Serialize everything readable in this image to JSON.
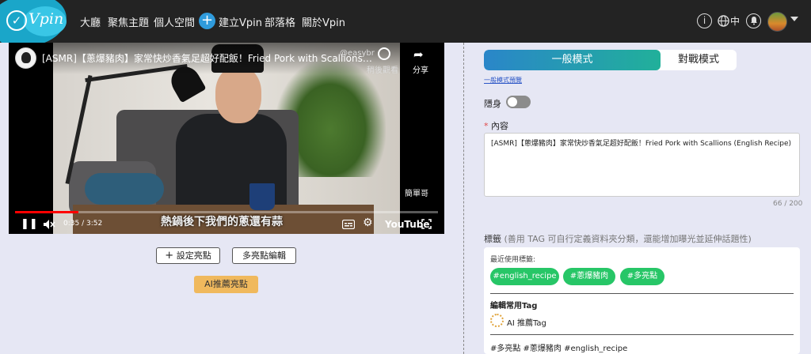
{
  "nav": {
    "logo_text": "Vpin",
    "items": [
      "大廳",
      "聚焦主題",
      "個人空間"
    ],
    "create": "建立Vpin",
    "blog": "部落格",
    "about": "關於Vpin",
    "info_icon": "i",
    "lang": "中"
  },
  "video": {
    "title": "[ASMR]【蔥爆豬肉】家常快炒香氣足超好配飯！Fried Pork with Scallions (English Recipe)",
    "watermark": "@easybr",
    "later_label": "稍後觀看",
    "share_label": "分享",
    "signature": "簡單哥",
    "subtitle": "熱鍋後下我們的蔥還有蒜",
    "time": "0:35 / 3:52",
    "progress": 0.15,
    "brand": "YouTube"
  },
  "actions": {
    "set_highlight": "設定亮點",
    "multi_edit": "多亮點編輯",
    "ai_recommend": "AI推薦亮點"
  },
  "editor": {
    "mode_general": "一般模式",
    "mode_battle": "對戰模式",
    "mode_link": "一般模式預覽",
    "hide_label": "隱身",
    "content_label": "內容",
    "content_value": "[ASMR]【蔥爆豬肉】家常快炒香氣足超好配飯！Fried Pork with Scallions (English Recipe)",
    "char_count": "66 / 200",
    "tag_label": "標籤",
    "tag_hint": "(善用 TAG 可自行定義資料夾分類，還能增加曝光並延伸話題性)",
    "recent_label": "最近使用標籤:",
    "recent_tags": [
      "#english_recipe",
      "#蔥爆豬肉",
      "#多亮點"
    ],
    "edit_common_label": "編輯常用Tag",
    "ai_tag": "AI 推薦Tag",
    "tag_summary": "#多亮點 #蔥爆豬肉 #english_recipe"
  },
  "icons": {
    "logo": "check-circle-icon",
    "create": "plus-circle-icon",
    "info": "info-icon",
    "globe": "globe-icon",
    "bell": "bell-icon",
    "watch_later": "clock-icon",
    "share": "share-arrow-icon",
    "play_pause": "pause-icon",
    "mute": "mute-icon",
    "captions": "captions-icon",
    "settings": "gear-icon",
    "fullscreen": "fullscreen-icon",
    "ai_tag": "sparkle-icon"
  },
  "colors": {
    "nav_bg": "#232323",
    "page_bg": "#e6e7f4",
    "chip_green": "#27c667",
    "ai_button": "#f0b95d",
    "accent_gradient_start": "#2a86c9",
    "accent_gradient_end": "#21b09a",
    "progress_red": "#ff0000"
  }
}
